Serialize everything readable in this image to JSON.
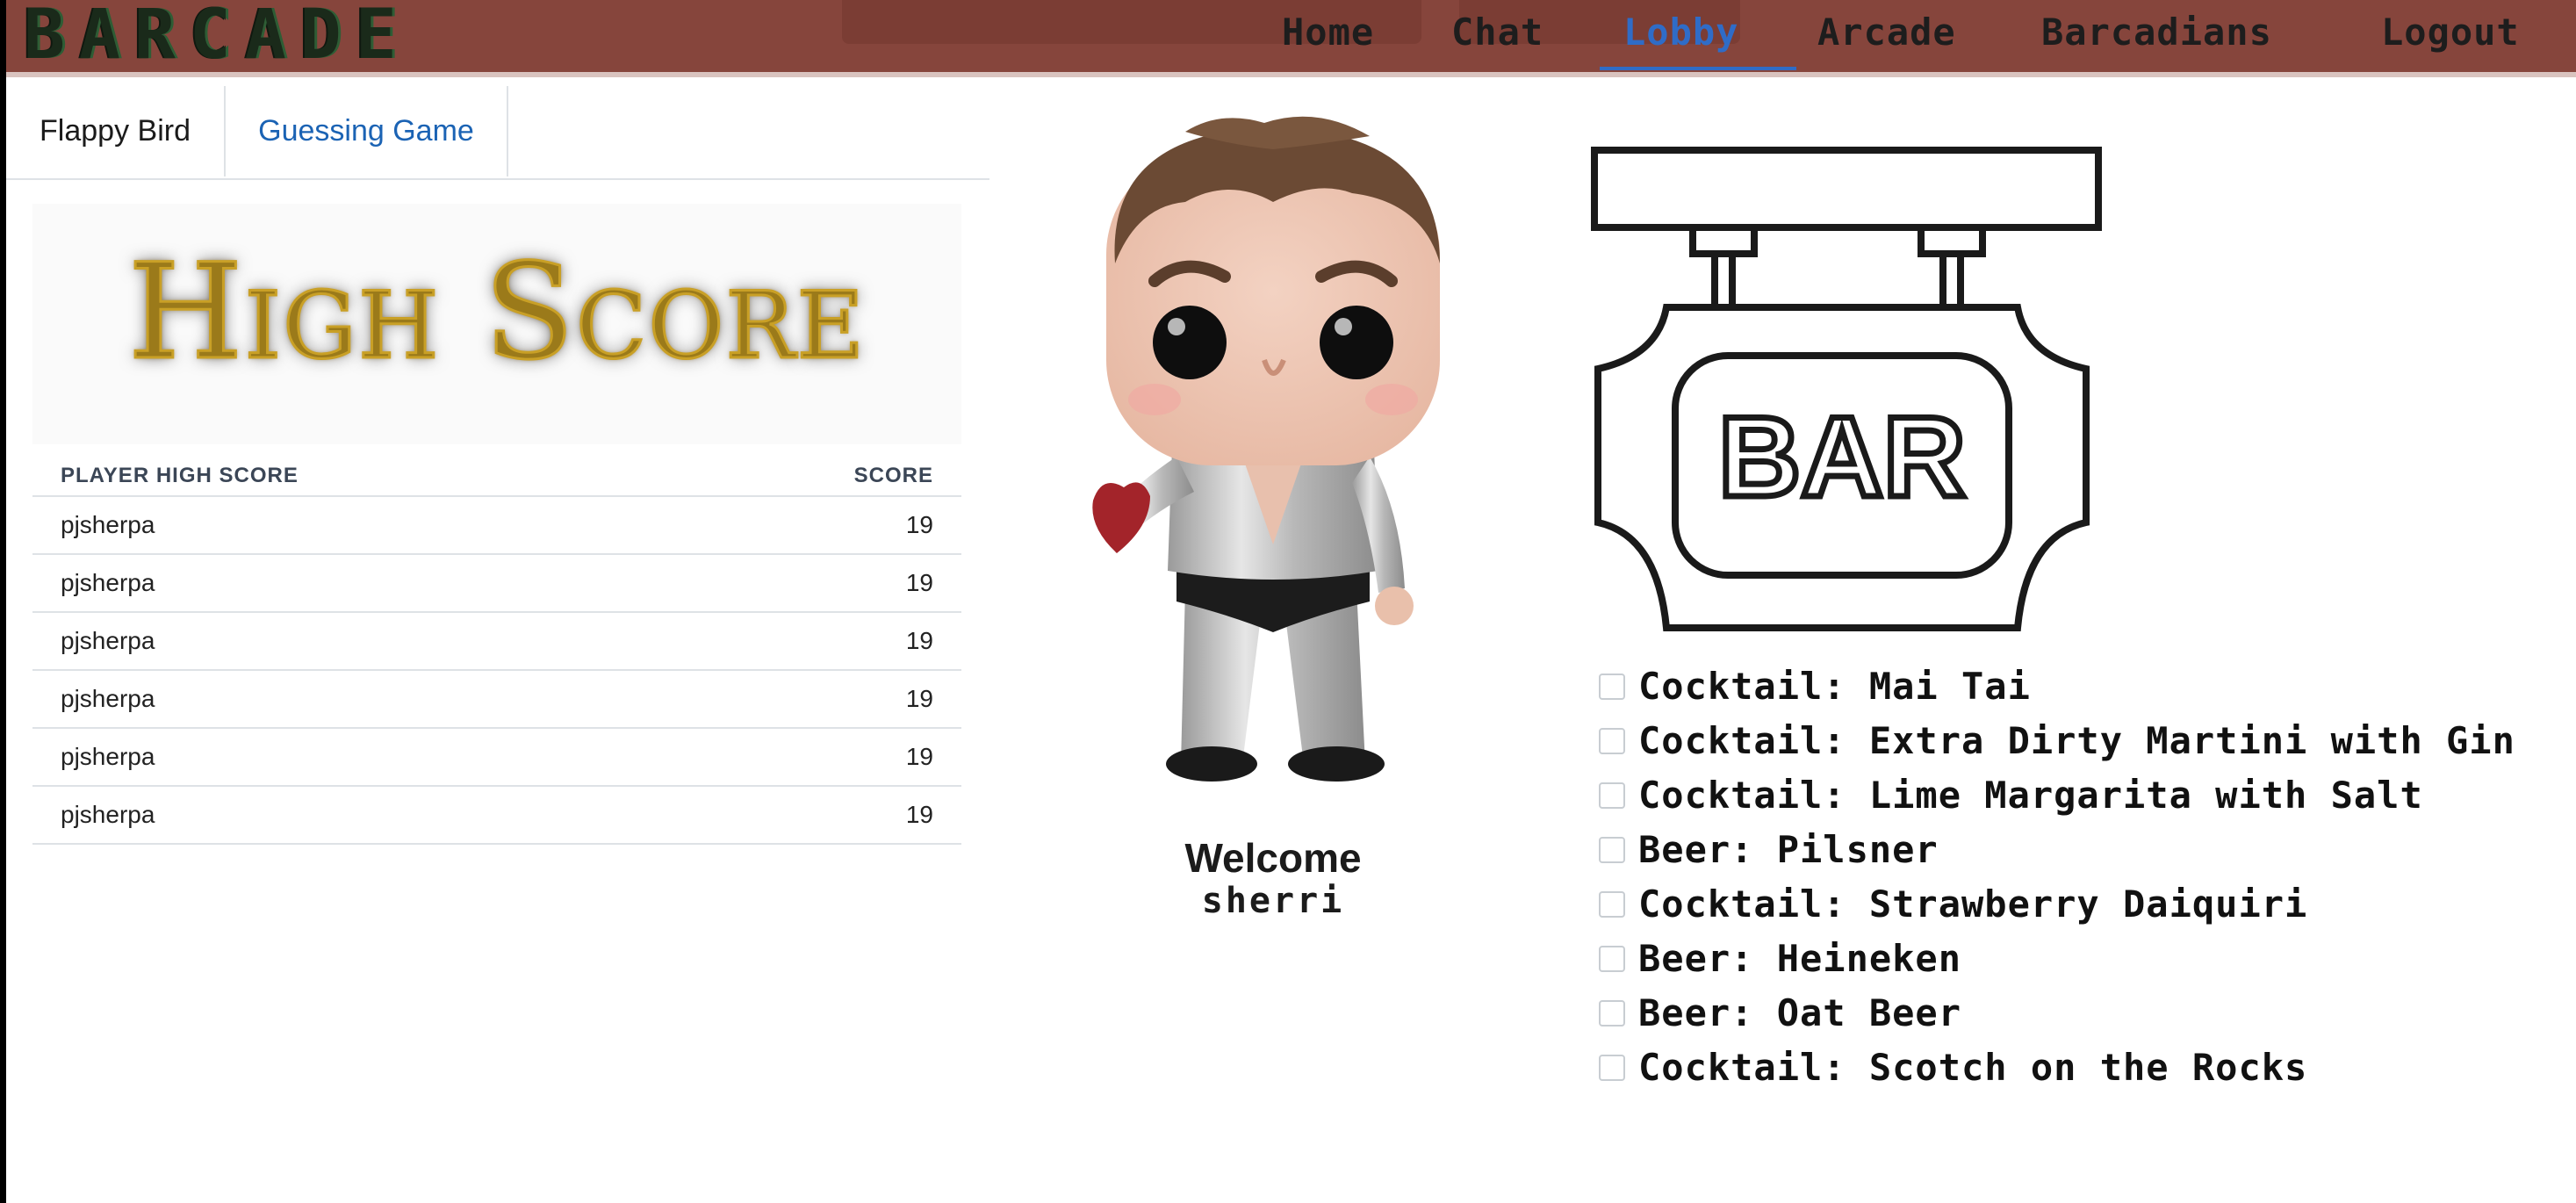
{
  "brand": "BARCADE",
  "nav": {
    "items": [
      {
        "label": "Home",
        "active": false
      },
      {
        "label": "Chat",
        "active": false
      },
      {
        "label": "Lobby",
        "active": true
      },
      {
        "label": "Arcade",
        "active": false
      },
      {
        "label": "Barcadians",
        "active": false
      },
      {
        "label": "Logout",
        "active": false
      }
    ]
  },
  "colors": {
    "navbar": "#86453c",
    "active_link": "#2f6cc7",
    "high_score_gold": "#c9a026"
  },
  "tabs": [
    {
      "label": "Flappy Bird",
      "active": false
    },
    {
      "label": "Guessing Game",
      "active": true
    }
  ],
  "high_score": {
    "banner_text": "High Score",
    "columns": [
      "PLAYER HIGH SCORE",
      "SCORE"
    ],
    "rows": [
      [
        "pjsherpa",
        "19"
      ],
      [
        "pjsherpa",
        "19"
      ],
      [
        "pjsherpa",
        "19"
      ],
      [
        "pjsherpa",
        "19"
      ],
      [
        "pjsherpa",
        "19"
      ],
      [
        "pjsherpa",
        "19"
      ]
    ]
  },
  "welcome": {
    "title": "Welcome",
    "username": "sherri"
  },
  "bar_sign": {
    "text": "BAR"
  },
  "drinks": [
    {
      "label": "Cocktail: Mai Tai",
      "checked": false
    },
    {
      "label": "Cocktail: Extra Dirty Martini with Gin",
      "checked": false
    },
    {
      "label": "Cocktail: Lime Margarita with Salt",
      "checked": false
    },
    {
      "label": "Beer: Pilsner",
      "checked": false
    },
    {
      "label": "Cocktail: Strawberry Daiquiri",
      "checked": false
    },
    {
      "label": "Beer: Heineken",
      "checked": false
    },
    {
      "label": "Beer: Oat Beer",
      "checked": false
    },
    {
      "label": "Cocktail: Scotch on the Rocks",
      "checked": false
    }
  ]
}
